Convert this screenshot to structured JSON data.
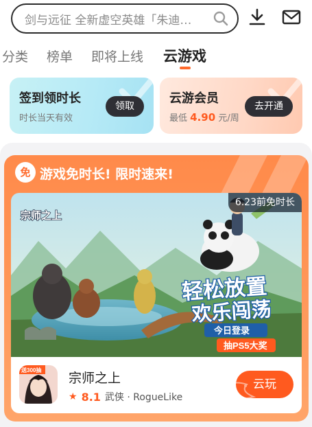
{
  "search": {
    "placeholder": "剑与远征 全新虚空英雄「朱迪…",
    "search_icon": "search-icon",
    "download_icon": "download-icon",
    "mail_icon": "mail-icon"
  },
  "tabs": [
    {
      "label": "分类",
      "active": false
    },
    {
      "label": "榜单",
      "active": false
    },
    {
      "label": "即将上线",
      "active": false
    },
    {
      "label": "云游戏",
      "active": true
    }
  ],
  "cards": {
    "checkin": {
      "title": "签到领时长",
      "subtitle": "时长当天有效",
      "button": "领取"
    },
    "membership": {
      "title": "云游会员",
      "subtitle_prefix": "最低",
      "price": "4.90",
      "subtitle_suffix": "元/周",
      "button": "去开通"
    }
  },
  "promo": {
    "badge": "免",
    "title": "游戏免时长! 限时速来!",
    "deadline": "6.23前免时长",
    "banner": {
      "logo_text": "宗师之上",
      "headline_1": "轻松放置",
      "headline_2": "欢乐闯荡",
      "ribbon_1": "今日登录",
      "ribbon_2": "抽PS5大奖"
    },
    "game": {
      "icon_badge": "送300抽",
      "name": "宗师之上",
      "rating": "8.1",
      "tags": "武侠 · RogueLike",
      "play_button": "云玩"
    }
  },
  "colors": {
    "accent": "#ff5a1f",
    "promo_bg": "#ff8a4a",
    "dark_button": "#2f2f35"
  }
}
